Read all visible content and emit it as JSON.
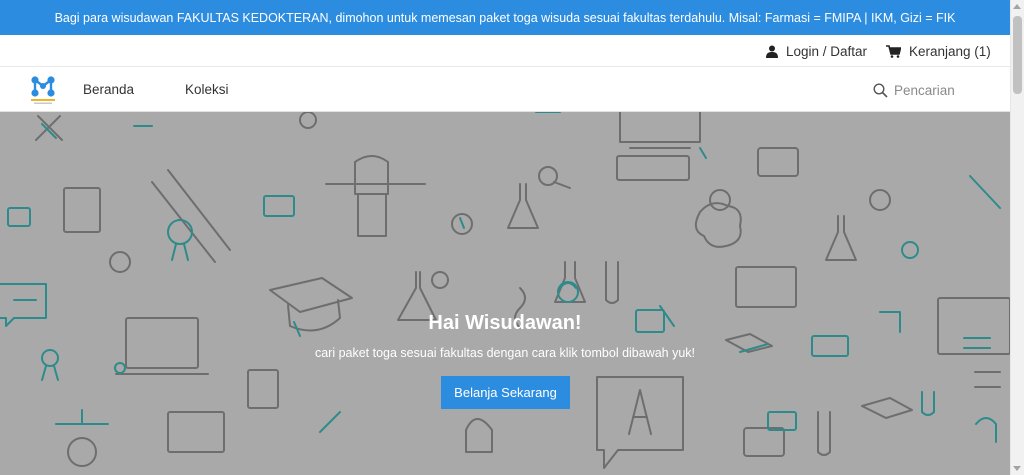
{
  "announcement": {
    "text": "Bagi para wisudawan FAKULTAS KEDOKTERAN, dimohon untuk memesan paket toga wisuda sesuai fakultas terdahulu. Misal: Farmasi = FMIPA | IKM, Gizi = FIK"
  },
  "utility": {
    "login_label": "Login / Daftar",
    "cart_label": "Keranjang (1)",
    "login_icon": "user-icon",
    "cart_icon": "cart-icon"
  },
  "nav": {
    "items": [
      {
        "label": "Beranda"
      },
      {
        "label": "Koleksi"
      }
    ],
    "search_placeholder": "Pencarian",
    "search_icon": "search-icon"
  },
  "hero": {
    "title": "Hai Wisudawan!",
    "subtitle": "cari paket toga sesuai fakultas dengan cara klik tombol dibawah yuk!",
    "cta_label": "Belanja Sekarang"
  },
  "colors": {
    "brand_blue": "#2c8ce0",
    "hero_background": "#a9a9a9",
    "icon_teal": "#2e8b8b",
    "icon_gray": "#6b6b6b"
  }
}
